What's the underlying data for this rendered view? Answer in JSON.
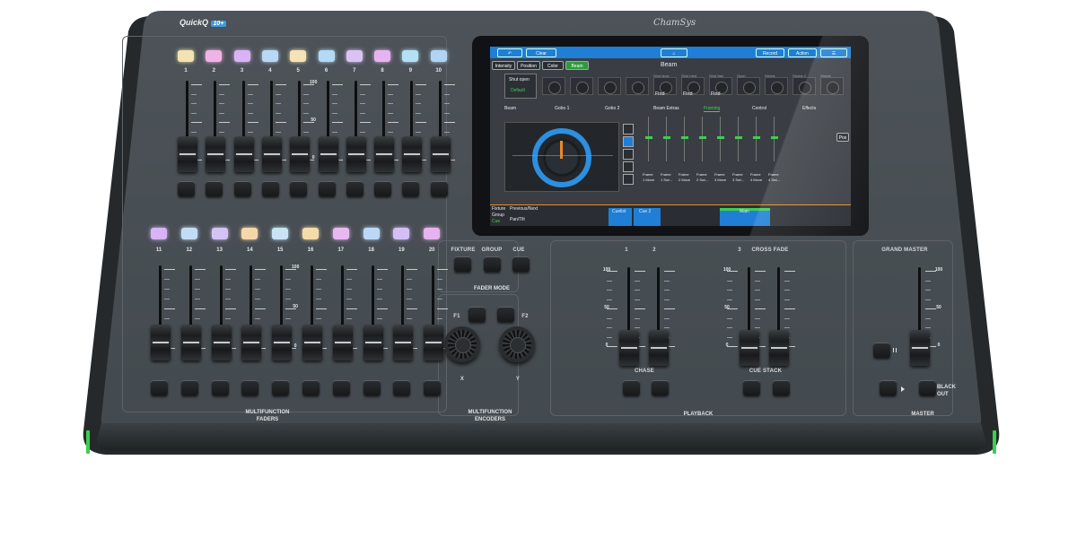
{
  "console": {
    "model": "QuickQ",
    "model_badge": "10+",
    "brand": "ChamSys"
  },
  "colors": {
    "body": "#4a5055",
    "frame": "#2c3034",
    "accent_green": "#3ccf4e",
    "screen_blue": "#1f7fd6"
  },
  "faders_top": {
    "numbers": [
      "1",
      "2",
      "3",
      "4",
      "5",
      "6",
      "7",
      "8",
      "9",
      "10"
    ],
    "scale": [
      "100",
      "50",
      "0"
    ],
    "levels": [
      0,
      0,
      0,
      0,
      0,
      0,
      0,
      0,
      0,
      0
    ],
    "select_colors": [
      "#f2e3b0",
      "#f0b3e6",
      "#d9b3f5",
      "#b9d8f5",
      "#f5e3b5",
      "#b3d9f5",
      "#d9c3f5",
      "#e6b3f0",
      "#b3e0f5",
      "#b3d3f5"
    ]
  },
  "faders_bottom": {
    "numbers": [
      "11",
      "12",
      "13",
      "14",
      "15",
      "16",
      "17",
      "18",
      "19",
      "20"
    ],
    "scale": [
      "100",
      "50",
      "0"
    ],
    "levels": [
      0,
      0,
      0,
      0,
      0,
      0,
      0,
      0,
      0,
      0
    ],
    "select_colors": [
      "#d8b3f5",
      "#c3dcf5",
      "#d3c3f5",
      "#f5d8a8",
      "#c8e3f5",
      "#f5dba8",
      "#e8b8f0",
      "#bcd8f5",
      "#d3bff5",
      "#e6b3ee"
    ]
  },
  "sections": {
    "multifunction_faders": "MULTIFUNCTION\nFADERS",
    "fader_mode": "FADER MODE",
    "multifunction_encoders": "MULTIFUNCTION\nENCODERS",
    "playback": "PLAYBACK",
    "master": "MASTER"
  },
  "fader_mode": {
    "buttons": [
      "FIXTURE",
      "GROUP",
      "CUE"
    ]
  },
  "encoders": {
    "f1": "F1",
    "f2": "F2",
    "x": "X",
    "y": "Y"
  },
  "playback": {
    "numbers": [
      "1",
      "2",
      "3"
    ],
    "crossfade": "CROSS FADE",
    "scale": [
      "100",
      "50",
      "0"
    ],
    "chase": "CHASE",
    "cue_stack": "CUE STACK",
    "levels": [
      0,
      0,
      0,
      0
    ]
  },
  "master": {
    "grand_master": "GRAND MASTER",
    "scale": [
      "100",
      "50",
      "0"
    ],
    "pause_icon": "pause-icon",
    "play_icon": "play-icon",
    "blackout": "BLACK\nOUT",
    "level": 0
  },
  "screen": {
    "toolbar": {
      "back_icon": "back-arrow-icon",
      "clear": "Clear",
      "home_icon": "home-icon",
      "record": "Record",
      "action": "Action",
      "menu_icon": "hamburger-menu-icon"
    },
    "attribute_tabs": [
      "Intensity",
      "Position",
      "Color",
      "Beam"
    ],
    "active_tab": "Beam",
    "heading": "Beam",
    "shut_open": "Shut open",
    "default": "Default",
    "dial_labels": [
      "Shut slow",
      "Shut med",
      "Shut fast",
      "Open",
      "Strobe",
      "Strobe 2",
      "Strobe"
    ],
    "find_labels": [
      "Find",
      "Find",
      "Find"
    ],
    "subtabs": [
      "Beam",
      "Gobo 1",
      "Gobo 2",
      "Beam Extras",
      "Framing",
      "Control",
      "Effects"
    ],
    "active_subtab": "Framing",
    "frame_labels": [
      [
        "Frame",
        "1 Move"
      ],
      [
        "Frame",
        "1 Swi..."
      ],
      [
        "Frame",
        "2 Move"
      ],
      [
        "Frame",
        "2 Swi..."
      ],
      [
        "Frame",
        "3 Move"
      ],
      [
        "Frame",
        "3 Swi..."
      ],
      [
        "Frame",
        "4 Move"
      ],
      [
        "Frame",
        "4 Swi..."
      ]
    ],
    "side_button": "Pos",
    "side_tabs": [
      "Fixture",
      "Group",
      "Cue"
    ],
    "options": [
      "Previous/Next",
      "Pan/Tilt"
    ],
    "cuelist": "Cuelist",
    "cue": "Cue 2",
    "main": "Main"
  }
}
